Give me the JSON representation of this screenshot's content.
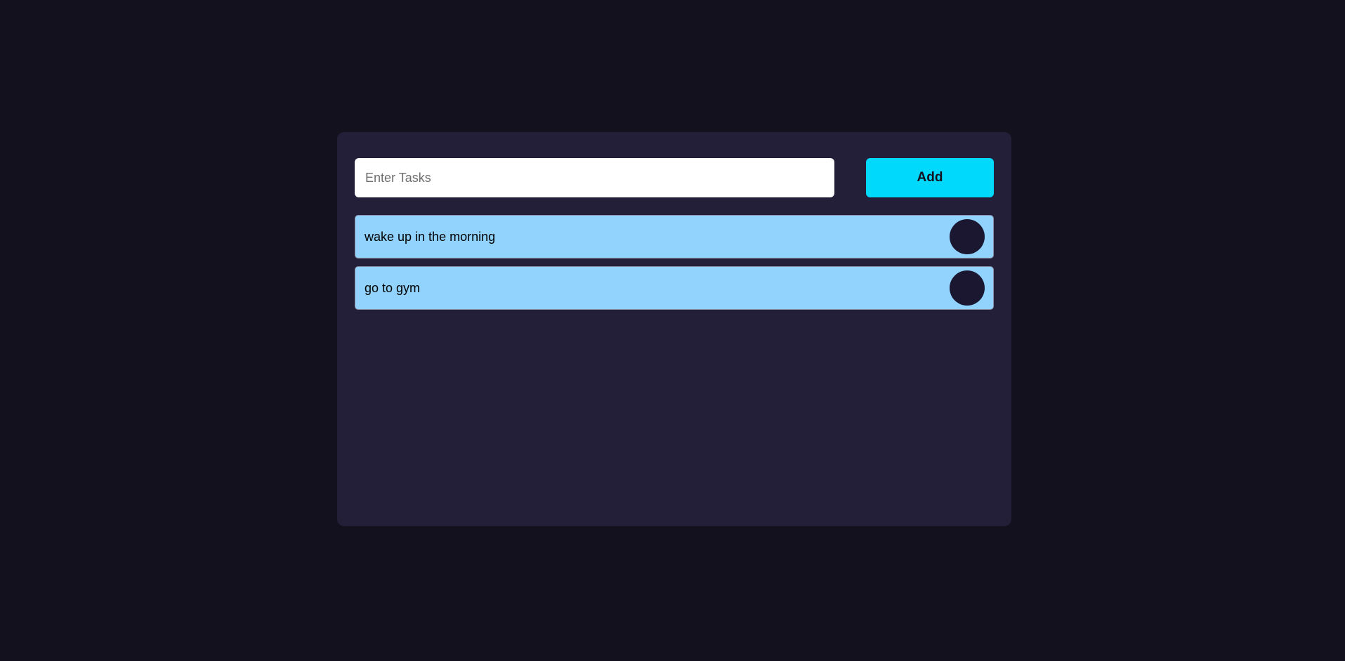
{
  "input": {
    "placeholder": "Enter Tasks",
    "value": ""
  },
  "add_button": {
    "label": "Add"
  },
  "tasks": [
    {
      "text": "wake up in the morning"
    },
    {
      "text": "go to gym"
    }
  ],
  "colors": {
    "background": "#14111f",
    "card": "#231f38",
    "accent": "#00d8fc",
    "task_item": "#91d3fd",
    "delete_button": "#1b1731"
  }
}
